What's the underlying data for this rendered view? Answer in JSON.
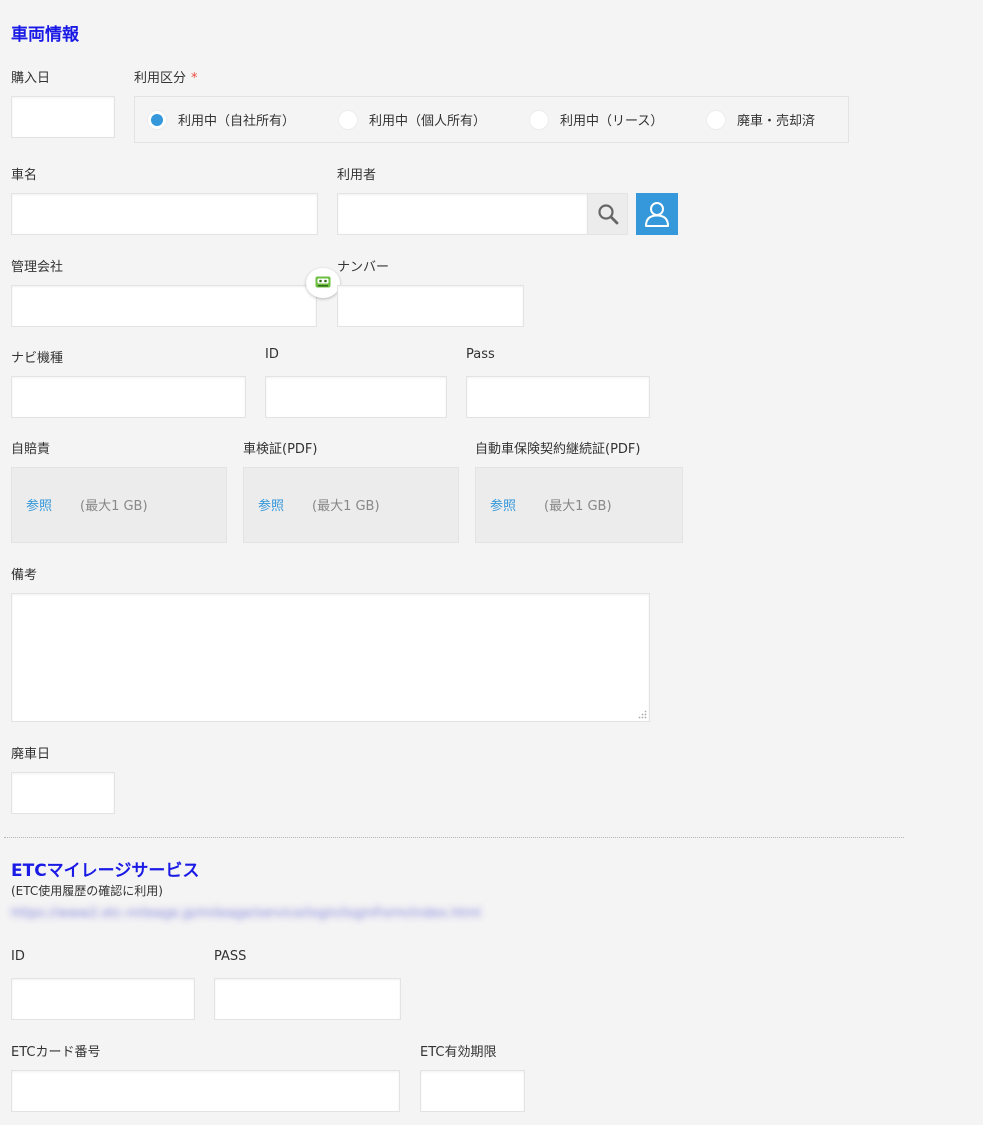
{
  "vehicle": {
    "title": "車両情報",
    "purchase_date": {
      "label": "購入日",
      "value": ""
    },
    "usage": {
      "label": "利用区分",
      "required_mark": "*",
      "options": [
        "利用中（自社所有）",
        "利用中（個人所有）",
        "利用中（リース）",
        "廃車・売却済"
      ],
      "selected": "利用中（自社所有）"
    },
    "car_name": {
      "label": "車名",
      "value": ""
    },
    "user": {
      "label": "利用者",
      "value": "",
      "search_icon": "search-icon",
      "user_icon": "user-icon"
    },
    "company": {
      "label": "管理会社",
      "value": ""
    },
    "number": {
      "label": "ナンバー",
      "value": ""
    },
    "navi": {
      "label": "ナビ機種",
      "value": ""
    },
    "navi_id": {
      "label": "ID",
      "value": ""
    },
    "navi_pass": {
      "label": "Pass",
      "value": ""
    },
    "files": [
      {
        "label": "自賠責",
        "browse": "参照",
        "max": "(最大1 GB)"
      },
      {
        "label": "車検証(PDF)",
        "browse": "参照",
        "max": "(最大1 GB)"
      },
      {
        "label": "自動車保険契約継続証(PDF)",
        "browse": "参照",
        "max": "(最大1 GB)"
      }
    ],
    "notes": {
      "label": "備考",
      "value": ""
    },
    "disposal_date": {
      "label": "廃車日",
      "value": ""
    }
  },
  "etc": {
    "title": "ETCマイレージサービス",
    "subtitle": "(ETC使用履歴の確認に利用)",
    "link": "https://www2.etc-mileage.jp/mileage/service/login/loginForm/index.html",
    "id": {
      "label": "ID",
      "value": ""
    },
    "pass": {
      "label": "PASS",
      "value": ""
    },
    "card_number": {
      "label": "ETCカード番号",
      "value": ""
    },
    "expiry": {
      "label": "ETC有効期限",
      "value": ""
    }
  },
  "colors": {
    "accent": "#3498db",
    "title": "#1a1ae6",
    "required": "#e74c3c",
    "background": "#f4f4f4"
  }
}
